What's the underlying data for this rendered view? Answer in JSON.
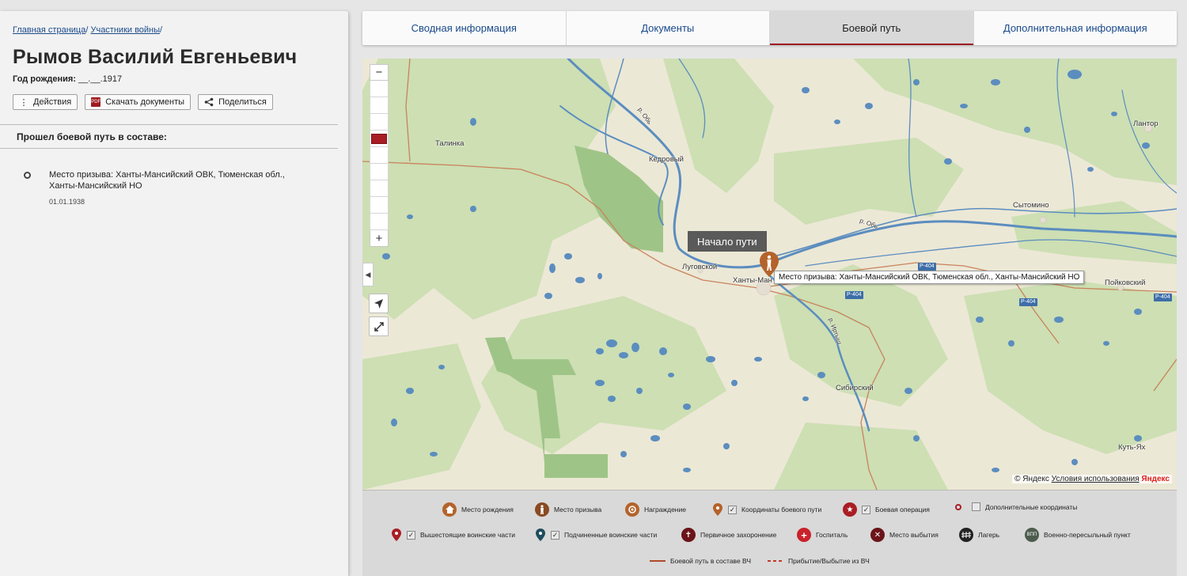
{
  "breadcrumb": {
    "home": "Главная страница",
    "section": "Участники войны",
    "separator": "/"
  },
  "person": {
    "name": "Рымов Василий Евгеньевич",
    "birth_label": "Год рождения:",
    "birth_value": "__.__.1917"
  },
  "actions": {
    "actions_label": "Действия",
    "download_label": "Скачать документы",
    "share_label": "Поделиться"
  },
  "path_section": {
    "title": "Прошел боевой путь в составе:",
    "items": [
      {
        "text": "Место призыва: Ханты-Мансийский ОВК, Тюменская обл., Ханты-Мансийский НО",
        "date": "01.01.1938"
      }
    ]
  },
  "tabs": [
    {
      "label": "Сводная информация",
      "active": false
    },
    {
      "label": "Документы",
      "active": false
    },
    {
      "label": "Боевой путь",
      "active": true
    },
    {
      "label": "Дополнительная информация",
      "active": false
    }
  ],
  "map": {
    "zoom_in": "+",
    "zoom_out": "−",
    "start_tooltip": "Начало пути",
    "place_hint": "Место призыва: Ханты-Мансийский ОВК, Тюменская обл., Ханты-Мансийский НО",
    "labels": {
      "talinka": "Талинка",
      "kedrovy": "Кедровый",
      "lugovskoy": "Луговской",
      "khanty": "Ханты-Ман",
      "lantor": "Лантор",
      "sytomino": "Сытомино",
      "poykovsky": "Пойковский",
      "sibirsky": "Сибирский",
      "kut_yakh": "Куть-Ях",
      "ob": "р. Обь",
      "ob2": "р. Обь",
      "irtysh": "р. Иртыш"
    },
    "roads": [
      "Р-404",
      "Р-404",
      "Р-404",
      "Р-404"
    ],
    "copyright": "© Яндекс",
    "terms": "Условия использования",
    "yandex": "Яндекс"
  },
  "legend": {
    "birth_place": "Место рождения",
    "conscription_place": "Место призыва",
    "award": "Награждение",
    "path_coords": "Координаты боевого пути",
    "combat_op": "Боевая операция",
    "extra_coords": "Дополнительные координаты",
    "higher_units": "Вышестоящие воинские части",
    "subordinate_units": "Подчиненные воинские части",
    "primary_burial": "Первичное захоронение",
    "hospital": "Госпиталь",
    "departure_place": "Место выбытия",
    "camp": "Лагерь",
    "vpp": "Военно-пересыльный пункт",
    "vpp_abbr": "ВПП",
    "path_line": "Боевой путь в составе ВЧ",
    "arrival_line": "Прибытие/Выбытие из ВЧ"
  },
  "colors": {
    "accent": "#9e1b20",
    "link": "#1a4a8a",
    "water": "#5b8dbf",
    "forest": "#c9dcae"
  }
}
